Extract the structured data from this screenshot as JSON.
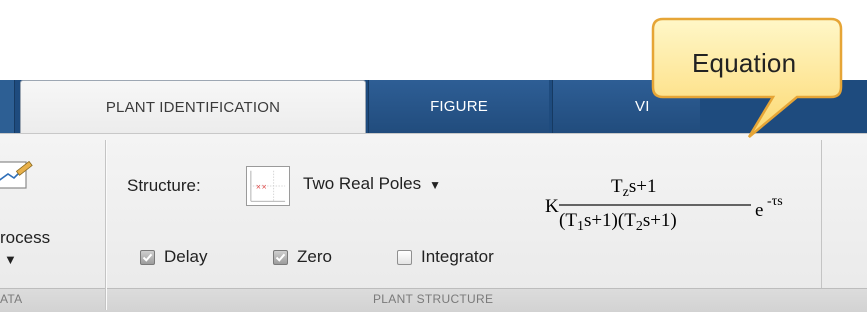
{
  "tabs": [
    {
      "label": "PLANT IDENTIFICATION",
      "active": true
    },
    {
      "label": "FIGURE",
      "active": false
    },
    {
      "label": "VI",
      "active": false
    }
  ],
  "left_group": {
    "button_label": "rocess",
    "section_label": "ATA"
  },
  "plant_structure": {
    "structure_label": "Structure:",
    "structure_value": "Two Real Poles",
    "checkboxes": [
      {
        "label": "Delay",
        "checked": true
      },
      {
        "label": "Zero",
        "checked": true
      },
      {
        "label": "Integrator",
        "checked": false
      }
    ],
    "section_label": "PLANT STRUCTURE"
  },
  "callout": {
    "text": "Equation"
  },
  "equation": {
    "gain": "K",
    "numerator": "T",
    "numerator_sub": "z",
    "numerator_rest": "s+1",
    "den_a": "(T",
    "den_a_sub": "1",
    "den_a_rest": "s+1)(T",
    "den_b_sub": "2",
    "den_b_rest": "s+1)",
    "exp_base": "e",
    "exp_power": "-τs"
  },
  "colors": {
    "tab_strip": "#1e4b7e",
    "callout_fill": "#fde68a",
    "callout_border": "#e6a536"
  }
}
